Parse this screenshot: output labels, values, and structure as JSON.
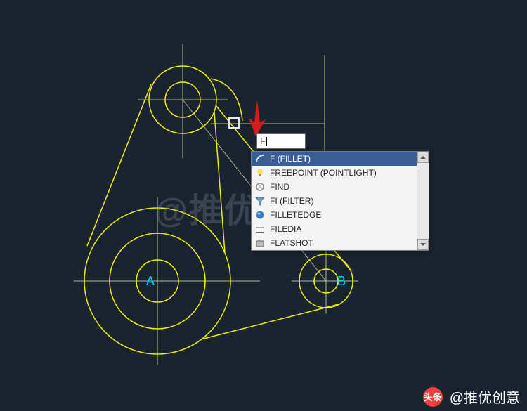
{
  "command_input": {
    "value": "F"
  },
  "autocomplete": {
    "items": [
      {
        "icon": "fillet-arc-icon",
        "label": "F (FILLET)",
        "selected": true
      },
      {
        "icon": "lightbulb-icon",
        "label": "FREEPOINT (POINTLIGHT)",
        "selected": false
      },
      {
        "icon": "find-circle-icon",
        "label": "FIND",
        "selected": false
      },
      {
        "icon": "funnel-icon",
        "label": "FI (FILTER)",
        "selected": false
      },
      {
        "icon": "sphere-icon",
        "label": "FILLETEDGE",
        "selected": false
      },
      {
        "icon": "dialog-icon",
        "label": "FILEDIA",
        "selected": false
      },
      {
        "icon": "camera-box-icon",
        "label": "FLATSHOT",
        "selected": false
      }
    ]
  },
  "drawing": {
    "labels": {
      "A": "A",
      "B": "B"
    },
    "construction_color": "#b8b890",
    "object_color": "#f0f000",
    "label_color": "#00d7ff"
  },
  "watermark_text": "@推优创意",
  "footer": {
    "brand_short": "头条",
    "author": "@推优创意"
  },
  "pointer_arrow_color": "#d21d1d"
}
